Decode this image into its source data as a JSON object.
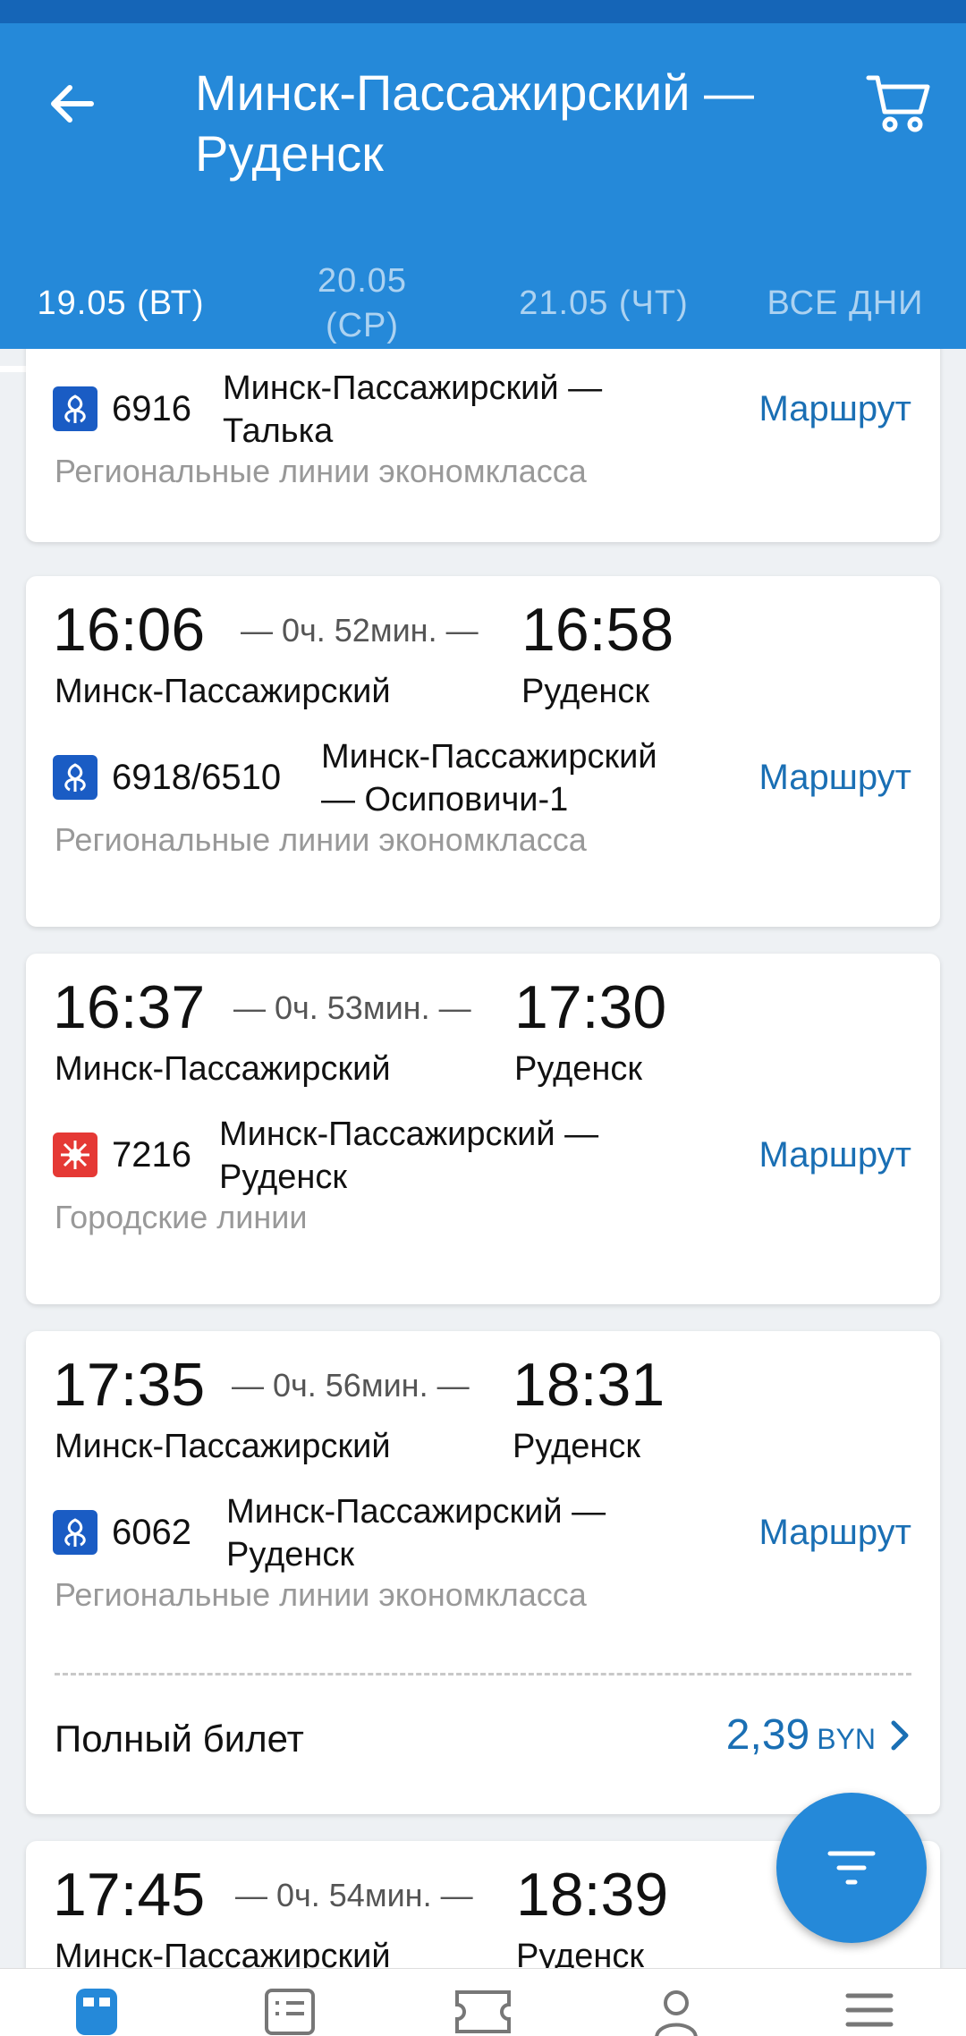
{
  "header": {
    "title_line1": "Минск-Пассажирский —",
    "title_line2": "Руденск"
  },
  "tabs": [
    {
      "line1": "19.05  (ВТ)",
      "line2": "",
      "active": true
    },
    {
      "line1": "20.05",
      "line2": "(СР)",
      "active": false
    },
    {
      "line1": "21.05  (ЧТ)",
      "line2": "",
      "active": false
    },
    {
      "line1": "ВСЕ ДНИ",
      "line2": "",
      "active": false
    }
  ],
  "trips": [
    {
      "train": "6916",
      "route_line1": "Минск-Пассажирский —",
      "route_line2": "Талька",
      "route_link": "Маршрут",
      "category": "Региональные линии экономкласса",
      "icon": "regional-line-icon"
    },
    {
      "dep_time": "16:06",
      "duration": "— 0ч. 52мин. —",
      "arr_time": "16:58",
      "dep_station": "Минск-Пассажирский",
      "arr_station": "Руденск",
      "train": "6918/6510",
      "route_line1": "Минск-Пассажирский",
      "route_line2": "— Осиповичи-1",
      "route_link": "Маршрут",
      "category": "Региональные линии экономкласса",
      "icon": "regional-line-icon"
    },
    {
      "dep_time": "16:37",
      "duration": "— 0ч. 53мин. —",
      "arr_time": "17:30",
      "dep_station": "Минск-Пассажирский",
      "arr_station": "Руденск",
      "train": "7216",
      "route_line1": "Минск-Пассажирский —",
      "route_line2": "Руденск",
      "route_link": "Маршрут",
      "category": "Городские линии",
      "icon": "city-line-icon"
    },
    {
      "dep_time": "17:35",
      "duration": "— 0ч. 56мин. —",
      "arr_time": "18:31",
      "dep_station": "Минск-Пассажирский",
      "arr_station": "Руденск",
      "train": "6062",
      "route_line1": "Минск-Пассажирский —",
      "route_line2": "Руденск",
      "route_link": "Маршрут",
      "category": "Региональные линии экономкласса",
      "icon": "regional-line-icon",
      "ticket_label": "Полный билет",
      "price": "2,39",
      "currency": "BYN"
    },
    {
      "dep_time": "17:45",
      "duration": "— 0ч. 54мин. —",
      "arr_time": "18:39",
      "dep_station": "Минск-Пассажирский",
      "arr_station": "Руденск"
    }
  ],
  "bottom_nav": [
    "trains-icon",
    "schedule-icon",
    "tickets-icon",
    "profile-icon",
    "menu-icon"
  ],
  "colors": {
    "primary": "#2589d9",
    "status_bar": "#1565b7",
    "link": "#1a6fb4",
    "regional_icon": "#1a5cc4",
    "city_icon": "#e53935"
  }
}
